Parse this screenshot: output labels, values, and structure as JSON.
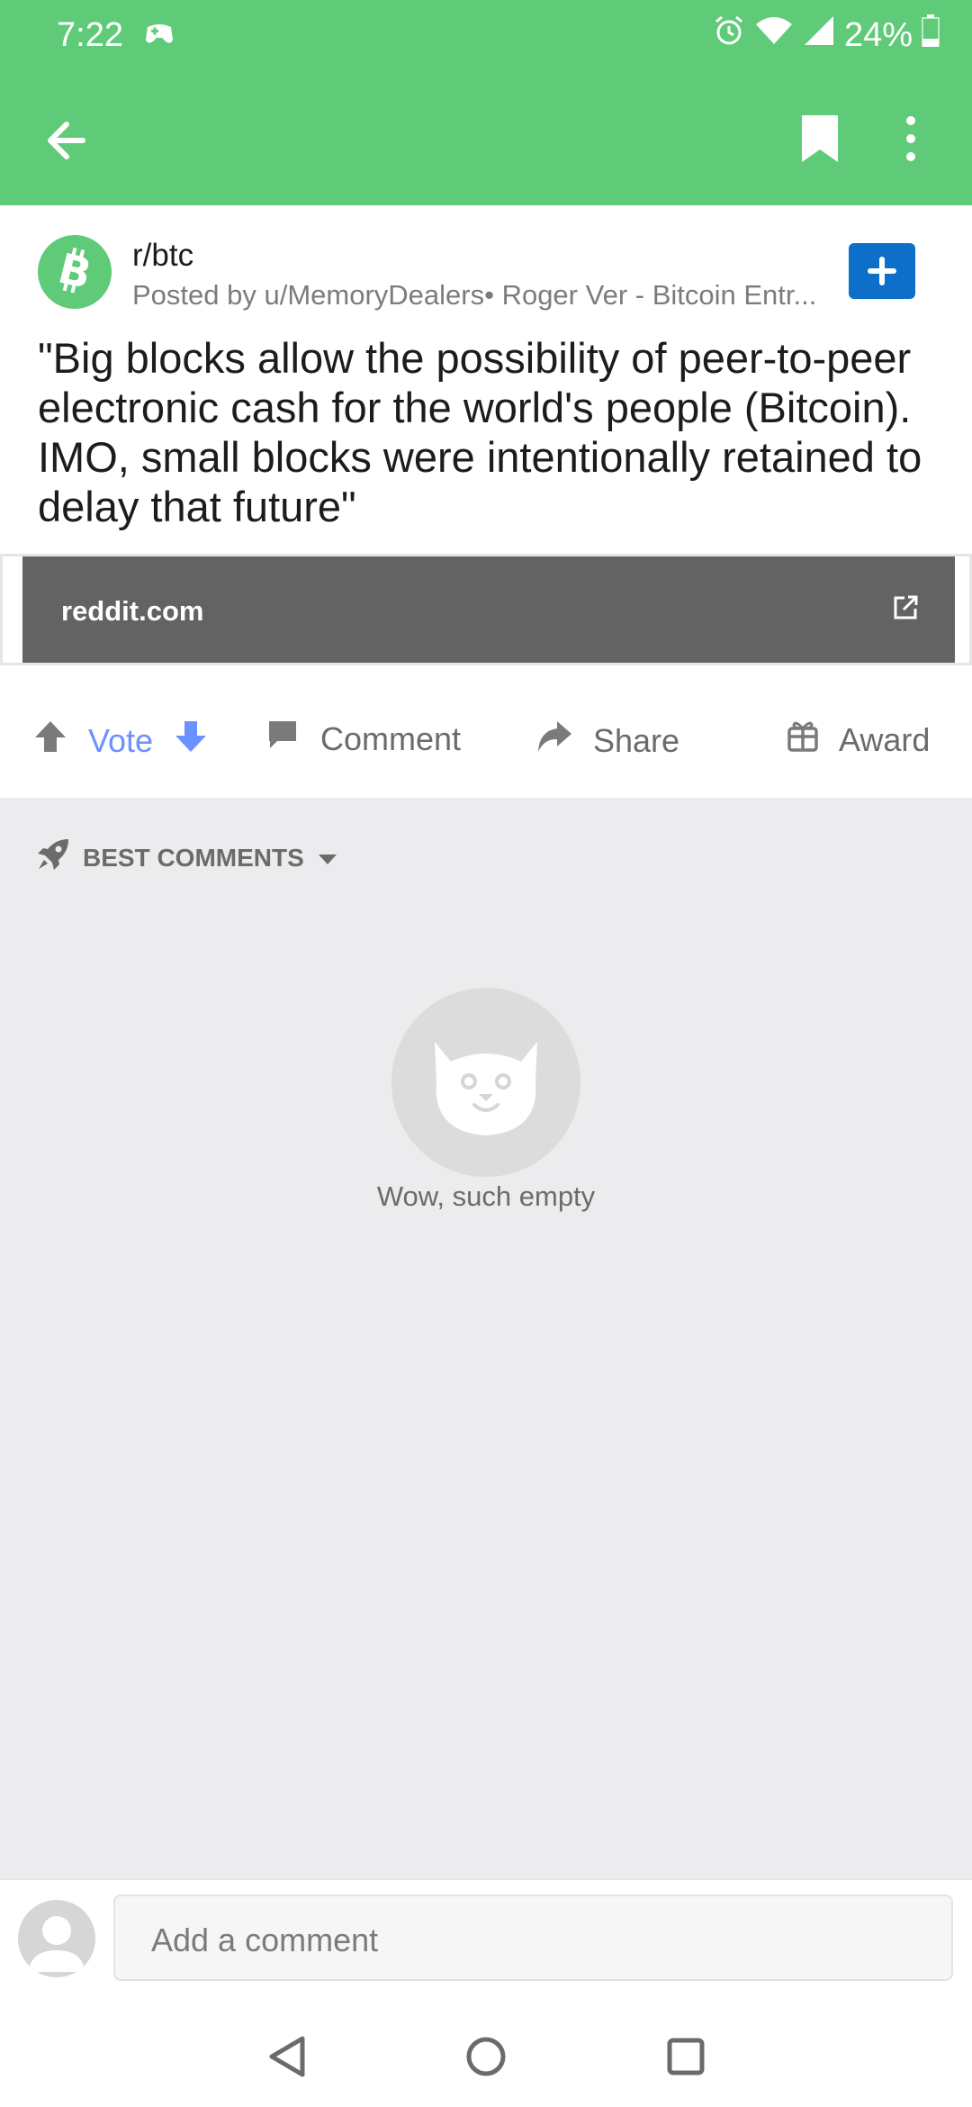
{
  "status_bar": {
    "time": "7:22",
    "battery": "24%"
  },
  "post": {
    "subreddit": "r/btc",
    "posted_by": "Posted by u/MemoryDealers• Roger Ver - Bitcoin Entr...",
    "title": "\"Big blocks allow the possibility of peer-to-peer electronic cash for the world's people (Bitcoin). IMO, small blocks were intentionally retained to delay that future\"",
    "link_domain": "reddit.com"
  },
  "actions": {
    "vote": "Vote",
    "comment": "Comment",
    "share": "Share",
    "award": "Award"
  },
  "comments": {
    "sort_label": "BEST COMMENTS",
    "empty_text": "Wow, such empty"
  },
  "composer": {
    "placeholder": "Add a comment"
  },
  "colors": {
    "brand_green": "#5fcb79",
    "join_blue": "#0d6fc9",
    "vote_blue": "#6b90ff"
  }
}
